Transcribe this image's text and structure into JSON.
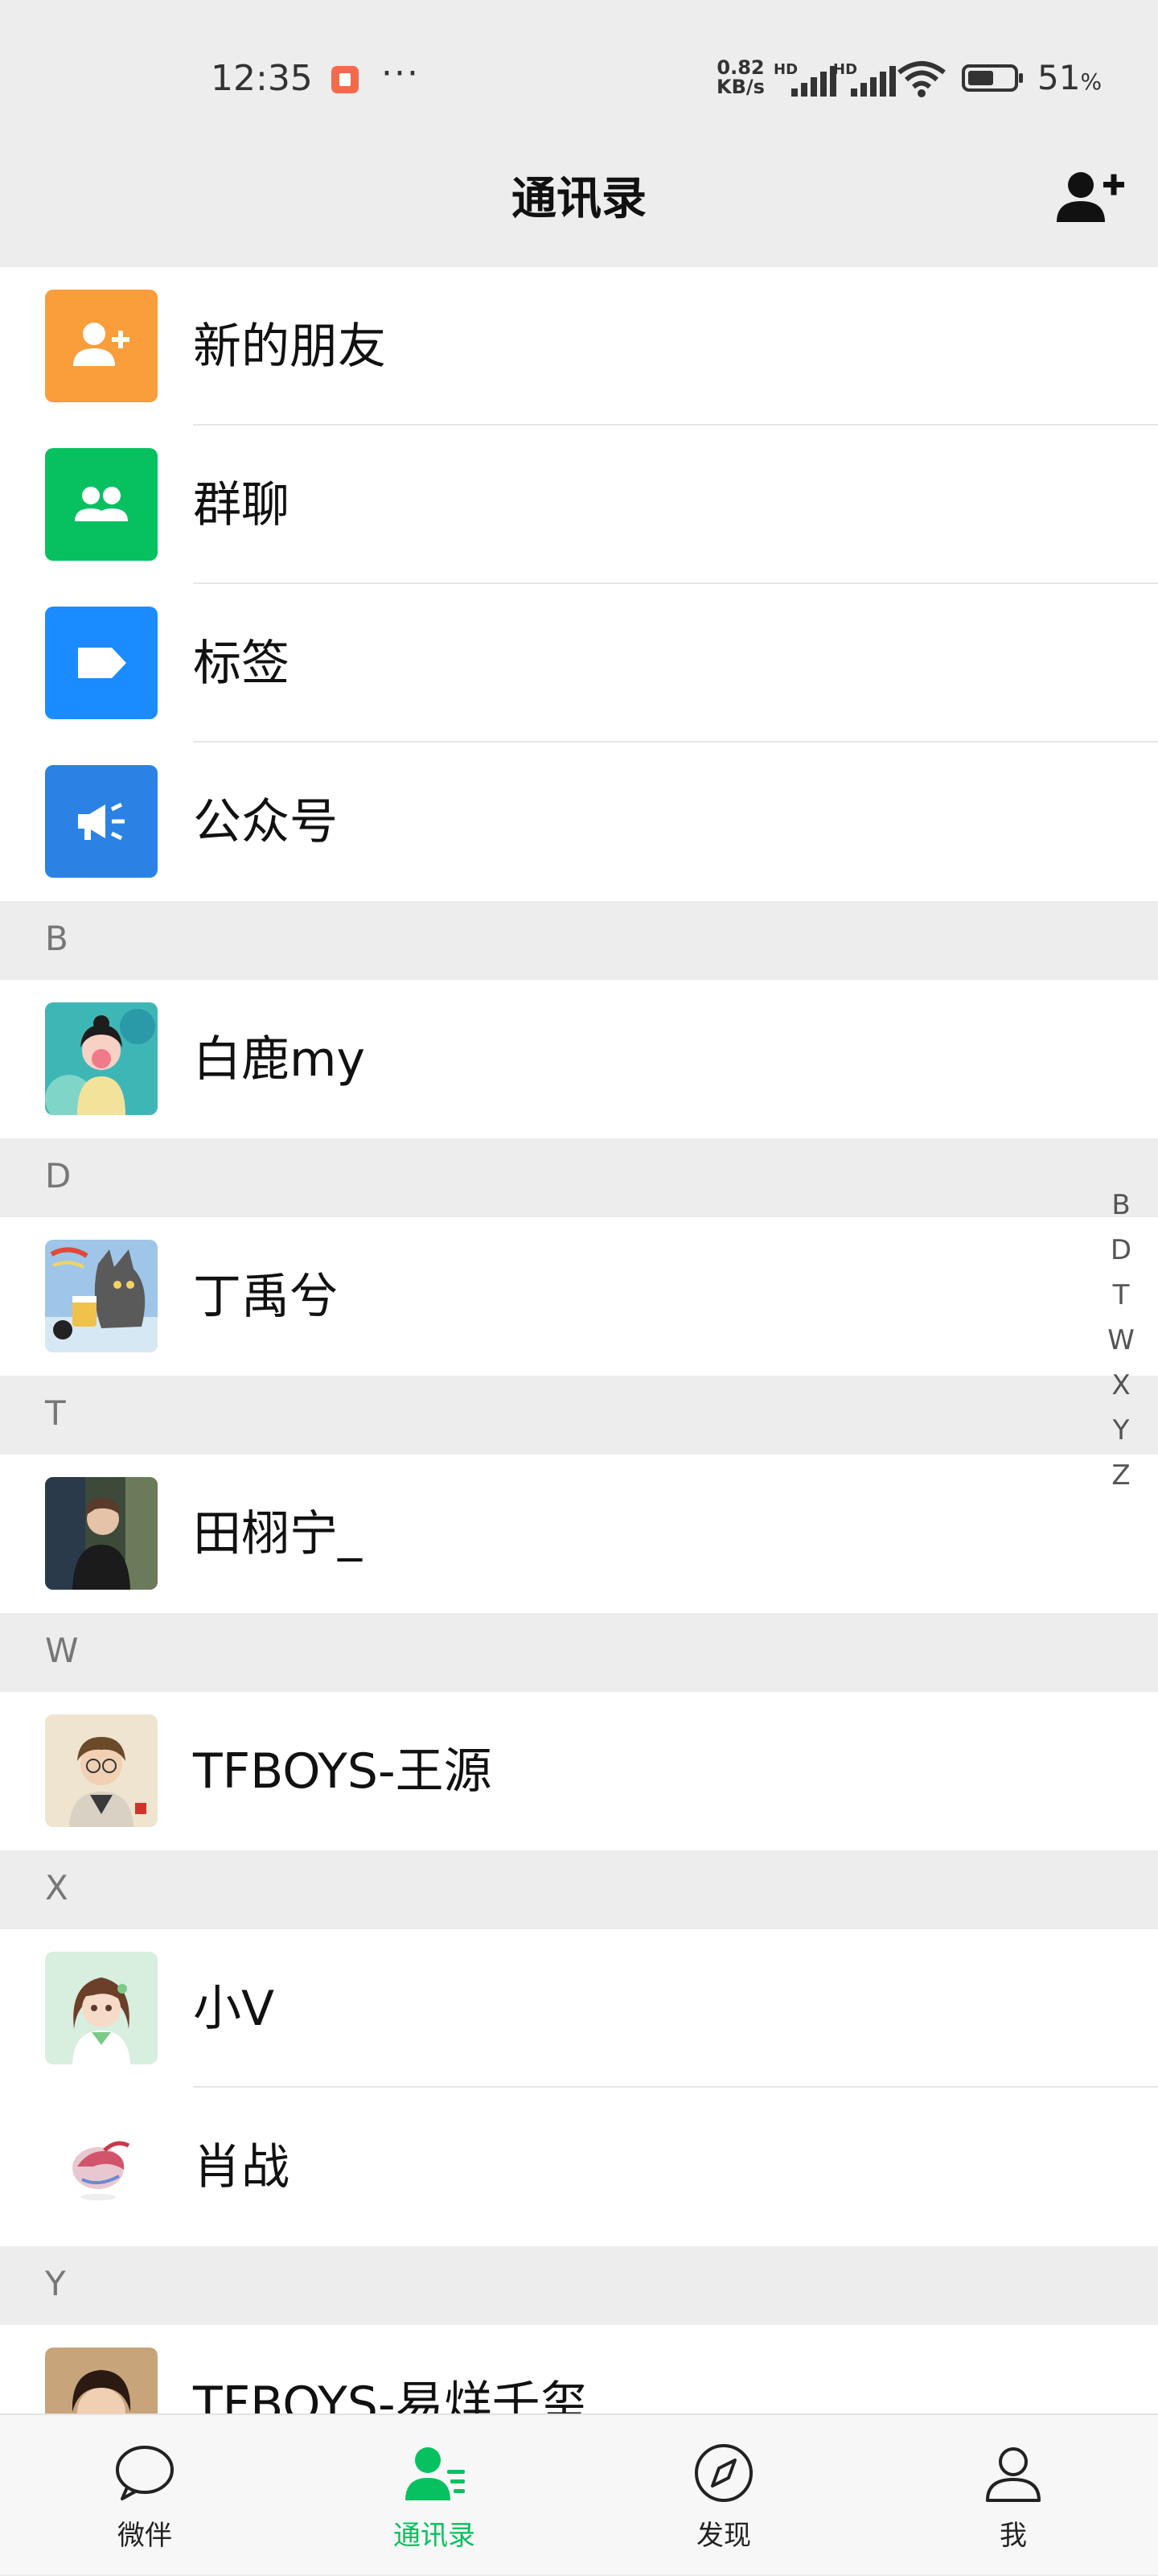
{
  "status_bar": {
    "time": "12:35",
    "dots": "···",
    "net_speed_value": "0.82",
    "net_speed_unit": "KB/s",
    "sim1": "HD",
    "sim2": "HD",
    "battery_percent": "51",
    "battery_unit": "%"
  },
  "header": {
    "title": "通讯录",
    "add_contact_icon": "add-user-icon"
  },
  "features": [
    {
      "label": "新的朋友",
      "icon": "new-friend-icon",
      "color": "#fa9d3b"
    },
    {
      "label": "群聊",
      "icon": "group-chat-icon",
      "color": "#07c160"
    },
    {
      "label": "标签",
      "icon": "tag-icon",
      "color": "#1a8cff"
    },
    {
      "label": "公众号",
      "icon": "official-account-icon",
      "color": "#2b82e4"
    }
  ],
  "sections": [
    {
      "letter": "B",
      "contacts": [
        {
          "name": "白鹿my"
        }
      ]
    },
    {
      "letter": "D",
      "contacts": [
        {
          "name": "丁禹兮"
        }
      ]
    },
    {
      "letter": "T",
      "contacts": [
        {
          "name": "田栩宁_"
        }
      ]
    },
    {
      "letter": "W",
      "contacts": [
        {
          "name": "TFBOYS-王源"
        }
      ]
    },
    {
      "letter": "X",
      "contacts": [
        {
          "name": "小V"
        },
        {
          "name": "肖战"
        }
      ]
    },
    {
      "letter": "Y",
      "contacts": [
        {
          "name": "TFBOYS-易烊千玺"
        }
      ]
    }
  ],
  "alphabet_index": [
    "B",
    "D",
    "T",
    "W",
    "X",
    "Y",
    "Z"
  ],
  "tabs": [
    {
      "label": "微伴",
      "icon": "chat-bubble-icon",
      "active": false
    },
    {
      "label": "通讯录",
      "icon": "contacts-icon",
      "active": true
    },
    {
      "label": "发现",
      "icon": "compass-icon",
      "active": false
    },
    {
      "label": "我",
      "icon": "profile-icon",
      "active": false
    }
  ],
  "colors": {
    "accent": "#07c160",
    "background": "#ededed"
  }
}
